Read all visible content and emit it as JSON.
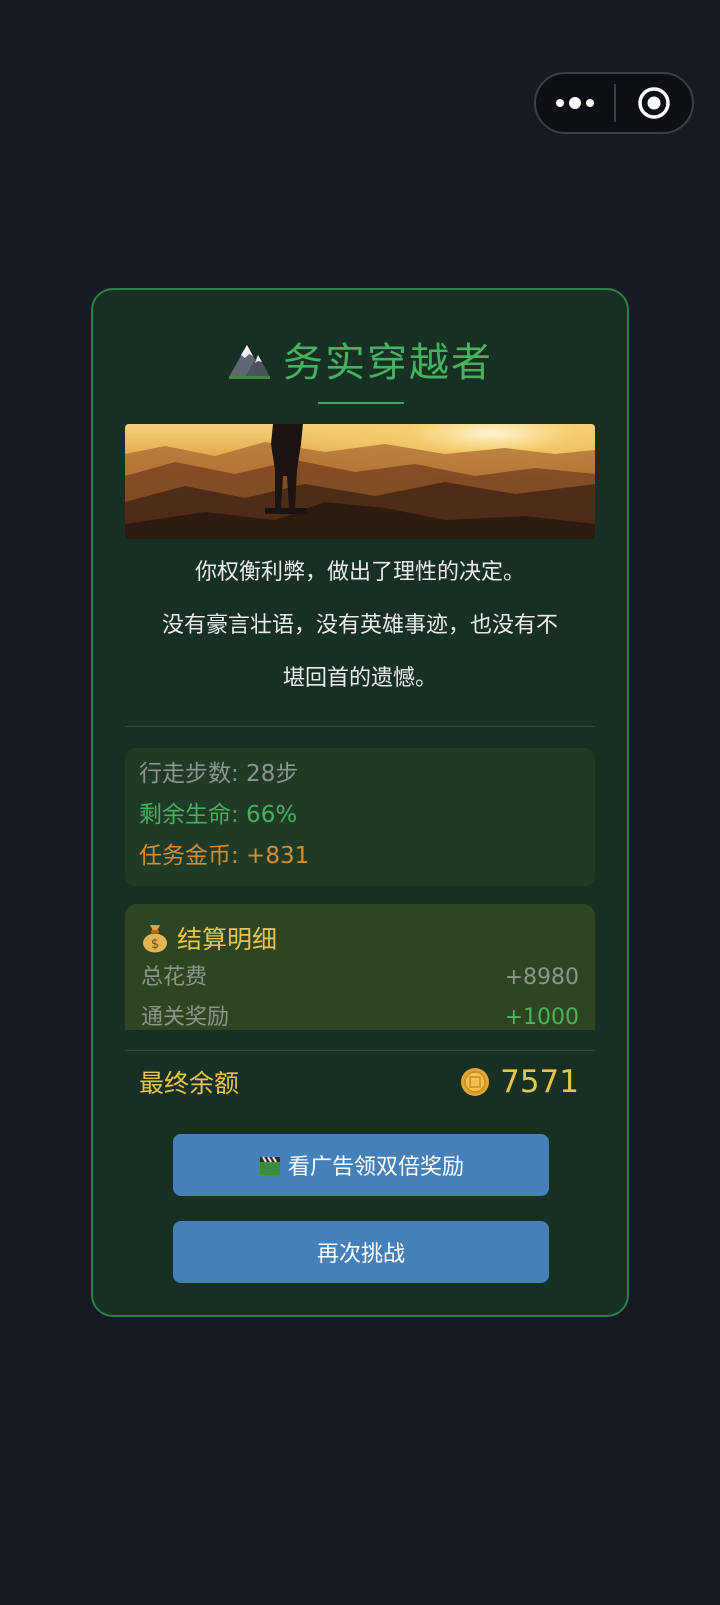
{
  "capsule": {
    "more_icon": "more-dots-icon",
    "close_icon": "target-close-icon"
  },
  "result": {
    "title": "务实穿越者",
    "title_icon": "mountain-icon",
    "banner": "hiker-on-mountain-sunset-image",
    "story": [
      "你权衡利弊，做出了理性的决定。",
      "没有豪言壮语，没有英雄事迹，也没有不",
      "堪回首的遗憾。"
    ],
    "stats": {
      "steps": "行走步数: 28步",
      "hp": "剩余生命: 66%",
      "coins": "任务金币: +831"
    },
    "settlement": {
      "icon": "money-bag-icon",
      "title": "结算明细",
      "rows": [
        {
          "label": "总花费",
          "value": "+8980"
        },
        {
          "label": "通关奖励",
          "value": "+1000"
        }
      ]
    },
    "final": {
      "label": "最终余额",
      "coin_icon": "coin-icon",
      "amount": "7571"
    },
    "buttons": {
      "ad_icon": "clapperboard-icon",
      "ad_label": "看广告领双倍奖励",
      "retry_label": "再次挑战"
    }
  },
  "colors": {
    "page_bg": "#151a23",
    "card_bg": "#183023",
    "card_border": "#2f7f47",
    "title_green": "#46b15e",
    "gold": "#e9c44a",
    "orange": "#d28f34",
    "button_blue": "#4581b8"
  }
}
